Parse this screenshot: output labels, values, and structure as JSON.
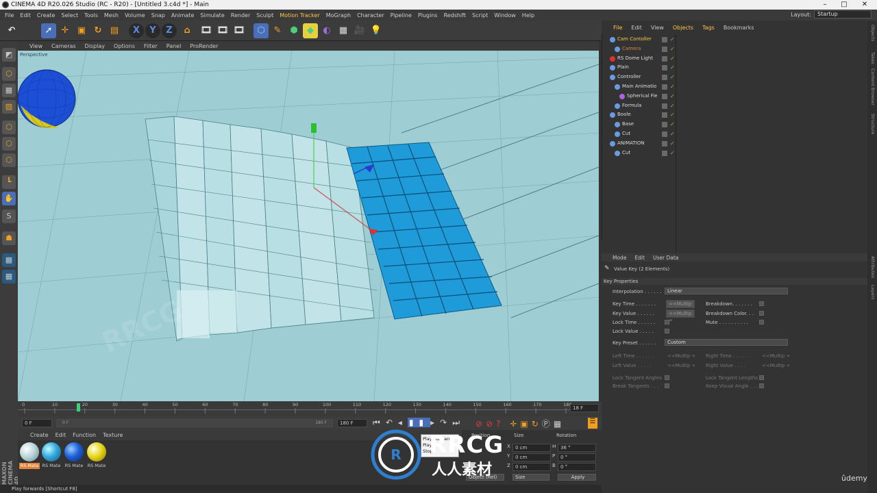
{
  "window": {
    "title": "CINEMA 4D R20.026 Studio (RC - R20) - [Untitled 3.c4d *] - Main",
    "min": "–",
    "max": "□",
    "close": "✕"
  },
  "menu": {
    "items": [
      "File",
      "Edit",
      "Create",
      "Select",
      "Tools",
      "Mesh",
      "Volume",
      "Snap",
      "Animate",
      "Simulate",
      "Render",
      "Sculpt",
      "Motion Tracker",
      "MoGraph",
      "Character",
      "Pipeline",
      "Plugins",
      "Redshift",
      "Script",
      "Window",
      "Help"
    ],
    "layout_label": "Layout:",
    "layout_value": "Startup"
  },
  "viewport": {
    "menu": [
      "View",
      "Cameras",
      "Display",
      "Options",
      "Filter",
      "Panel",
      "ProRender"
    ],
    "label": "Perspective"
  },
  "timeline": {
    "ticks": [
      "0",
      "10",
      "20",
      "30",
      "40",
      "50",
      "60",
      "70",
      "80",
      "90",
      "100",
      "110",
      "120",
      "130",
      "140",
      "150",
      "160",
      "170",
      "180"
    ],
    "current_frame": "18 F",
    "start_field": "0 F",
    "start_field2": "0 F",
    "end_field": "180 F",
    "end_field2": "180 F"
  },
  "tooltip": {
    "lines": [
      "Play Forwards",
      "Play",
      "Stop"
    ]
  },
  "materials": {
    "menu": [
      "Create",
      "Edit",
      "Function",
      "Texture"
    ],
    "items": [
      {
        "label": "RS Mate",
        "color": "#bcd6da",
        "selected": true
      },
      {
        "label": "RS Mate",
        "color": "#35a8e0",
        "selected": false
      },
      {
        "label": "RS Mate",
        "color": "#1d5fd6",
        "selected": false
      },
      {
        "label": "RS Mate",
        "color": "#e8d61a",
        "selected": false
      }
    ]
  },
  "coords": {
    "headers": [
      "Position",
      "Size",
      "Rotation"
    ],
    "rows": [
      {
        "axis": "X",
        "pos": "0 cm",
        "size_axis": "X",
        "size": "0 cm",
        "rot_axis": "H",
        "rot": "36 °"
      },
      {
        "axis": "Y",
        "pos": "0 cm",
        "size_axis": "Y",
        "size": "0 cm",
        "rot_axis": "P",
        "rot": "0 °"
      },
      {
        "axis": "Z",
        "pos": "0 cm",
        "size_axis": "Z",
        "size": "0 cm",
        "rot_axis": "B",
        "rot": "0 °"
      }
    ],
    "mode1": "Object (Rel)",
    "mode2": "Size",
    "apply": "Apply"
  },
  "status": "Play forwards [Shortcut F8]",
  "objects": {
    "menu": [
      "File",
      "Edit",
      "View",
      "Objects",
      "Tags",
      "Bookmarks"
    ],
    "rows": [
      {
        "name": "Cam Contoller",
        "indent": 0,
        "color": "#ffc547"
      },
      {
        "name": "Camera",
        "indent": 1,
        "color": "#e0833a"
      },
      {
        "name": "RS Dome Light",
        "indent": 0,
        "color": "#ddd"
      },
      {
        "name": "Plain",
        "indent": 0,
        "color": "#ddd"
      },
      {
        "name": "Controller",
        "indent": 0,
        "color": "#ddd"
      },
      {
        "name": "Main Animatio",
        "indent": 1,
        "color": "#ddd"
      },
      {
        "name": "Spherical Fie",
        "indent": 2,
        "color": "#ddd"
      },
      {
        "name": "Formula",
        "indent": 1,
        "color": "#ddd"
      },
      {
        "name": "Boole",
        "indent": 0,
        "color": "#ddd"
      },
      {
        "name": "Base",
        "indent": 1,
        "color": "#ddd"
      },
      {
        "name": "Cut",
        "indent": 1,
        "color": "#ddd"
      },
      {
        "name": "ANIMATION",
        "indent": 0,
        "color": "#ddd"
      },
      {
        "name": "Cut",
        "indent": 1,
        "color": "#ddd"
      }
    ]
  },
  "attributes": {
    "menu": [
      "Mode",
      "Edit",
      "User Data"
    ],
    "title": "Value Key (2 Elements)",
    "section": "Key Properties",
    "interpolation_label": "Interpolation . . . . . .",
    "interpolation_value": "Linear",
    "key_time": "Key Time . . . . . . .",
    "key_value": "Key Value . . . . . .",
    "multiple": "<<Multip ÷",
    "lock_time": "Lock Time . . . . . .",
    "lock_value": "Lock Value . . . . .",
    "breakdown": "Breakdown. . . . . . .",
    "breakdown_color": "Breakdown Color. . .",
    "mute": "Mute . . . . . . . . . .",
    "key_preset_label": "Key Preset . . . . . .",
    "key_preset_value": "Custom",
    "left_time": "Left Time . . . . . .",
    "left_value": "Left Value . . . . .",
    "right_time": "Right Time . . . . .",
    "right_value": "Right Value . . . .",
    "multip": "<<Multip ÷",
    "lock_tangent_angles": "Lock Tangent Angles",
    "break_tangents": "Break Tangents . . .",
    "lock_tangent_lengths": "Lock Tangent Lengths",
    "keep_visual_angle": "Keep Visual Angle . . ."
  },
  "side_tabs": [
    "Objects",
    "Takes",
    "Content Browser",
    "Structure",
    "Attributes",
    "Layers"
  ],
  "watermark": {
    "brand": "RRCG",
    "sub": "人人素材",
    "udemy": "ûdemy"
  }
}
